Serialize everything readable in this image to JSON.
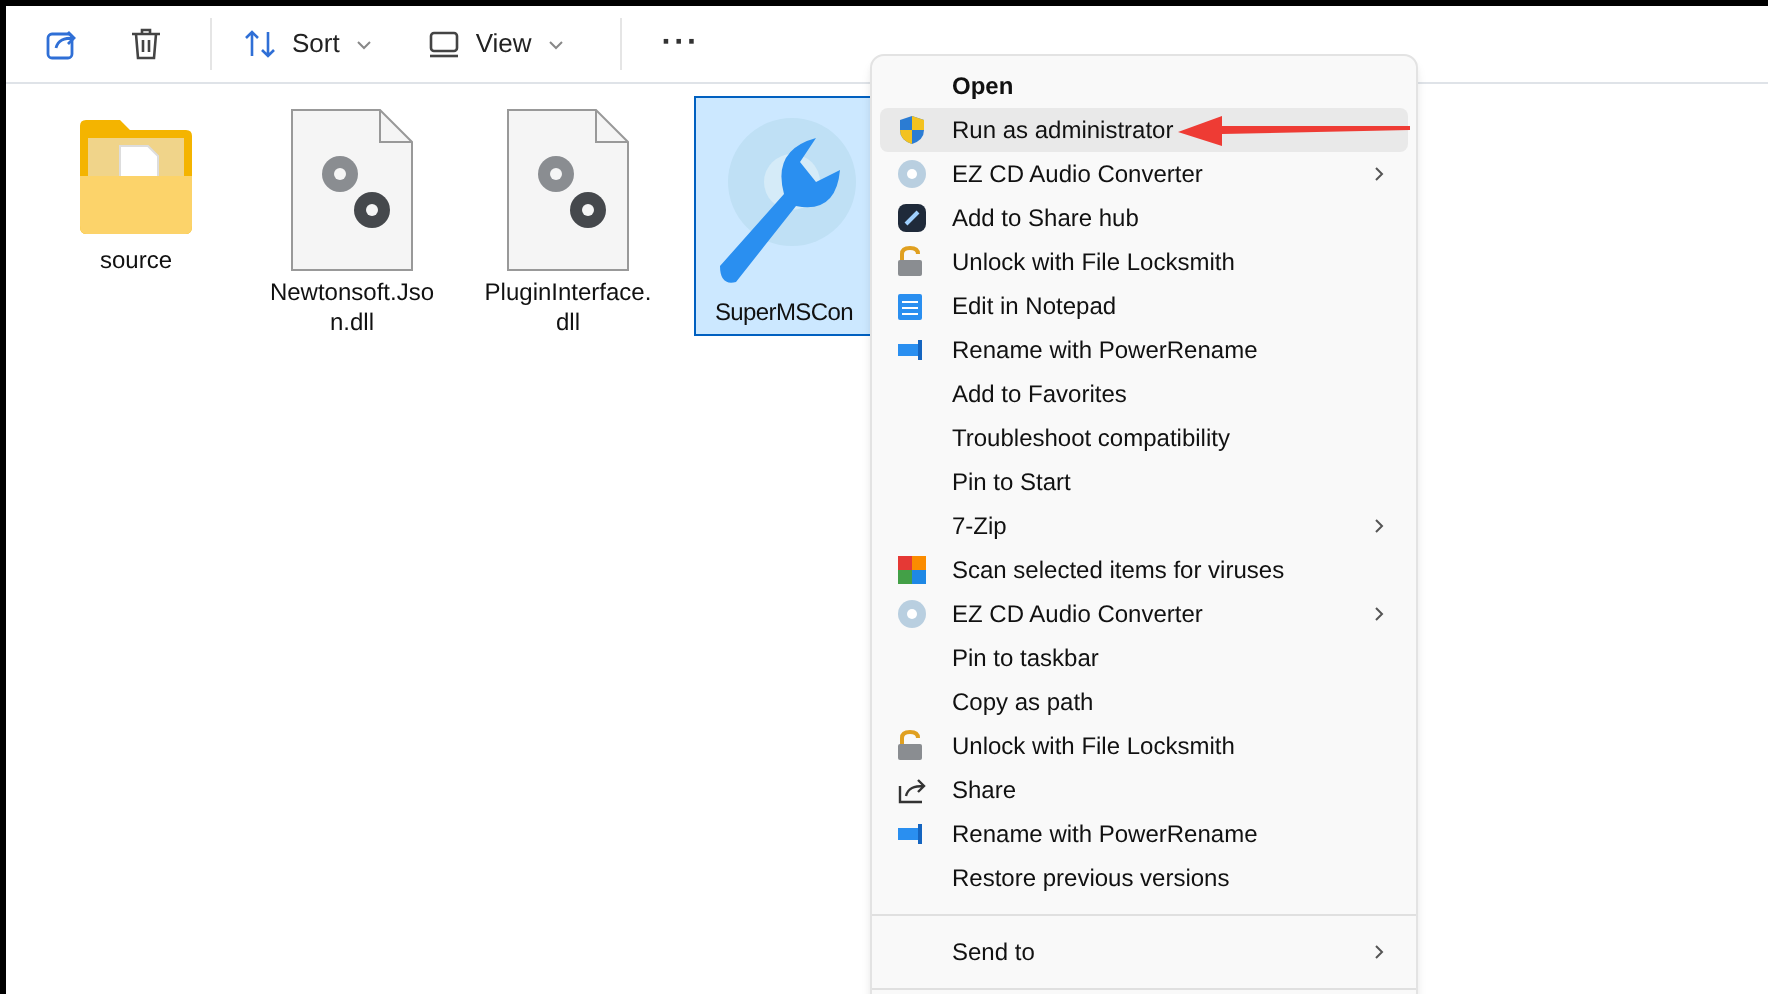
{
  "toolbar": {
    "buttons": [
      {
        "kind": "share"
      },
      {
        "kind": "delete"
      },
      {
        "kind": "sort",
        "label": "Sort",
        "dropdown": true
      },
      {
        "kind": "view",
        "label": "View",
        "dropdown": true
      },
      {
        "kind": "more",
        "label": "···"
      }
    ]
  },
  "files": [
    {
      "kind": "folder",
      "name": "source",
      "selected": false
    },
    {
      "kind": "dll",
      "name": "Newtonsoft.Json.dll",
      "selected": false
    },
    {
      "kind": "dll",
      "name": "PluginInterface.dll",
      "selected": false
    },
    {
      "kind": "exe",
      "name": "SuperMSCon",
      "selected": true
    }
  ],
  "context_menu": {
    "items": [
      {
        "label": "Open",
        "kind": "plain",
        "bold": true,
        "submenu": false,
        "selected": false
      },
      {
        "label": "Run as administrator",
        "kind": "shield",
        "bold": false,
        "submenu": false,
        "selected": true
      },
      {
        "label": "EZ CD Audio Converter",
        "kind": "disc",
        "bold": false,
        "submenu": true,
        "selected": false
      },
      {
        "label": "Add to Share hub",
        "kind": "hub",
        "bold": false,
        "submenu": false,
        "selected": false
      },
      {
        "label": "Unlock with File Locksmith",
        "kind": "lock",
        "bold": false,
        "submenu": false,
        "selected": false
      },
      {
        "label": "Edit in Notepad",
        "kind": "notepad",
        "bold": false,
        "submenu": false,
        "selected": false
      },
      {
        "label": "Rename with PowerRename",
        "kind": "rename",
        "bold": false,
        "submenu": false,
        "selected": false
      },
      {
        "label": "Add to Favorites",
        "kind": "plain",
        "bold": false,
        "submenu": false,
        "selected": false
      },
      {
        "label": "Troubleshoot compatibility",
        "kind": "plain",
        "bold": false,
        "submenu": false,
        "selected": false
      },
      {
        "label": "Pin to Start",
        "kind": "plain",
        "bold": false,
        "submenu": false,
        "selected": false
      },
      {
        "label": "7-Zip",
        "kind": "plain",
        "bold": false,
        "submenu": true,
        "selected": false
      },
      {
        "label": "Scan selected items for viruses",
        "kind": "scan",
        "bold": false,
        "submenu": false,
        "selected": false
      },
      {
        "label": "EZ CD Audio Converter",
        "kind": "disc",
        "bold": false,
        "submenu": true,
        "selected": false
      },
      {
        "label": "Pin to taskbar",
        "kind": "plain",
        "bold": false,
        "submenu": false,
        "selected": false
      },
      {
        "label": "Copy as path",
        "kind": "plain",
        "bold": false,
        "submenu": false,
        "selected": false
      },
      {
        "label": "Unlock with File Locksmith",
        "kind": "lock",
        "bold": false,
        "submenu": false,
        "selected": false
      },
      {
        "label": "Share",
        "kind": "share",
        "bold": false,
        "submenu": false,
        "selected": false
      },
      {
        "label": "Rename with PowerRename",
        "kind": "rename",
        "bold": false,
        "submenu": false,
        "selected": false
      },
      {
        "label": "Restore previous versions",
        "kind": "plain",
        "bold": false,
        "submenu": false,
        "selected": false
      },
      {
        "kind": "separator"
      },
      {
        "label": "Send to",
        "kind": "plain",
        "bold": false,
        "submenu": true,
        "selected": false
      },
      {
        "kind": "separator"
      }
    ]
  }
}
